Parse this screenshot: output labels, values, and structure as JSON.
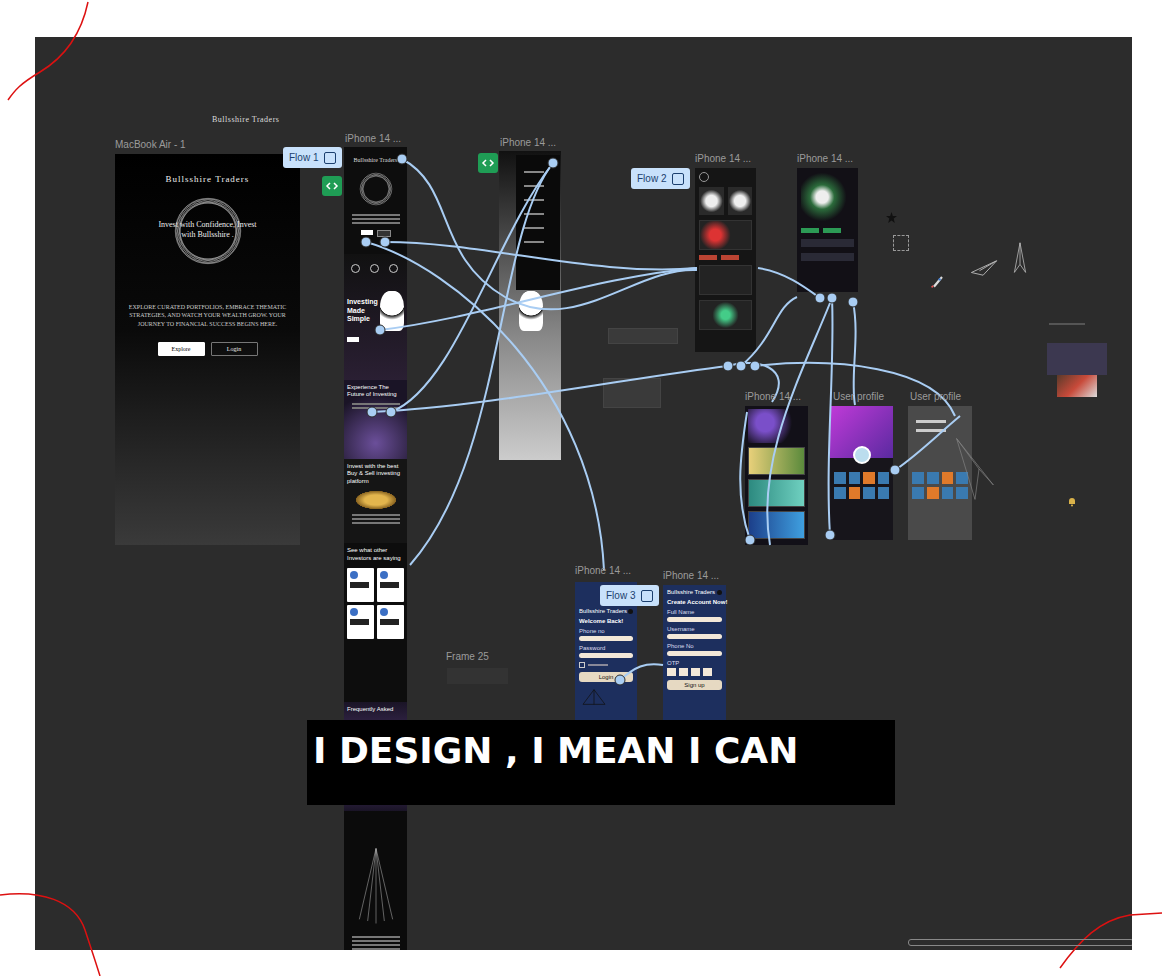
{
  "canvas": {
    "title": "Bullsshire Traders"
  },
  "desktop": {
    "label": "MacBook Air - 1",
    "brand": "Bullsshire Traders",
    "headline": "Invest with Confidence, Invest with Bullsshire .",
    "body": "EXPLORE CURATED PORTFOLIOS, EMBRACE THEMATIC STRATEGIES, AND WATCH YOUR WEALTH GROW. YOUR JOURNEY TO FINANCIAL SUCCESS BEGINS HERE.",
    "buttons": [
      {
        "label": "Explore",
        "kind": "primary"
      },
      {
        "label": "Login",
        "kind": "outline"
      }
    ]
  },
  "landing": {
    "label": "iPhone 14 ...",
    "flow": "Flow 1",
    "brand": "Bullsshire Traders",
    "sections": [
      {
        "kind": "figure",
        "title": "Investing Made Simple"
      },
      {
        "kind": "glow",
        "title": "Experience The Future of Investing"
      },
      {
        "kind": "coins",
        "title": "Invest with the best Buy & Sell investing platform"
      },
      {
        "kind": "reviews",
        "title": "See what other Investors are saying"
      },
      {
        "kind": "faq",
        "title": "Frequently Asked"
      }
    ]
  },
  "menu_phone": {
    "label": "iPhone 14 ..."
  },
  "home_phone": {
    "label": "iPhone 14 ...",
    "flow": "Flow 2"
  },
  "market_phone": {
    "label": "iPhone 14 ..."
  },
  "portfolio_phone": {
    "label": "iPhone 14 ..."
  },
  "profiles": [
    {
      "label": "User profile",
      "kind": "card"
    },
    {
      "label": "User profile",
      "kind": "menu"
    }
  ],
  "login": {
    "label": "iPhone 14 ...",
    "flow": "Flow 3",
    "brand": "Bullsshire Traders",
    "title": "Welcome Back!",
    "fields": [
      "Phone no",
      "Password"
    ],
    "button": "Login"
  },
  "signup": {
    "label": "iPhone 14 ...",
    "brand": "Bullsshire Traders",
    "title": "Create Account Now!",
    "fields": [
      "Full Name",
      "Username",
      "Phone No"
    ],
    "otp_label": "OTP",
    "button": "Sign up"
  },
  "extra_frame": {
    "label": "Frame 25"
  },
  "caption": "I DESIGN , I MEAN I CAN"
}
